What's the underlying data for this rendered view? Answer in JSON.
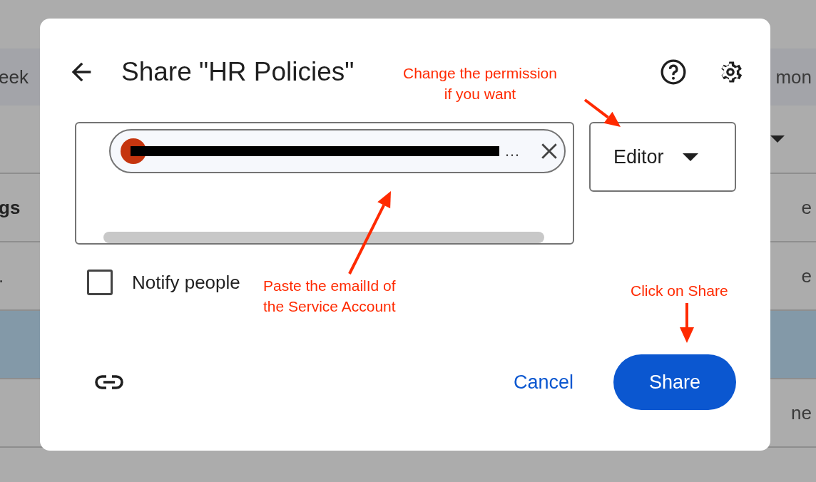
{
  "background": {
    "rows": [
      {
        "kind": "top"
      },
      {
        "kind": "band",
        "left": "eek",
        "right": "mon"
      },
      {
        "kind": "row",
        "caret": true
      },
      {
        "kind": "row",
        "left": "gs",
        "right": "e",
        "bold": true
      },
      {
        "kind": "row",
        "left": ".",
        "right": "e"
      },
      {
        "kind": "row",
        "selected": true
      },
      {
        "kind": "row",
        "right": "ne"
      }
    ]
  },
  "dialog": {
    "title": "Share \"HR Policies\"",
    "recipients": [
      {
        "kind": "redacted",
        "text": "…"
      }
    ],
    "role": {
      "value": "Editor"
    },
    "notify": {
      "label": "Notify people",
      "checked": false
    },
    "actions": [
      {
        "kind": "text",
        "label": "Cancel"
      },
      {
        "kind": "primary",
        "label": "Share"
      }
    ]
  },
  "annotations": [
    {
      "text": "Change the permission\nif you want"
    },
    {
      "text": "Paste the emailId of\nthe Service Account"
    },
    {
      "text": "Click on Share"
    }
  ]
}
